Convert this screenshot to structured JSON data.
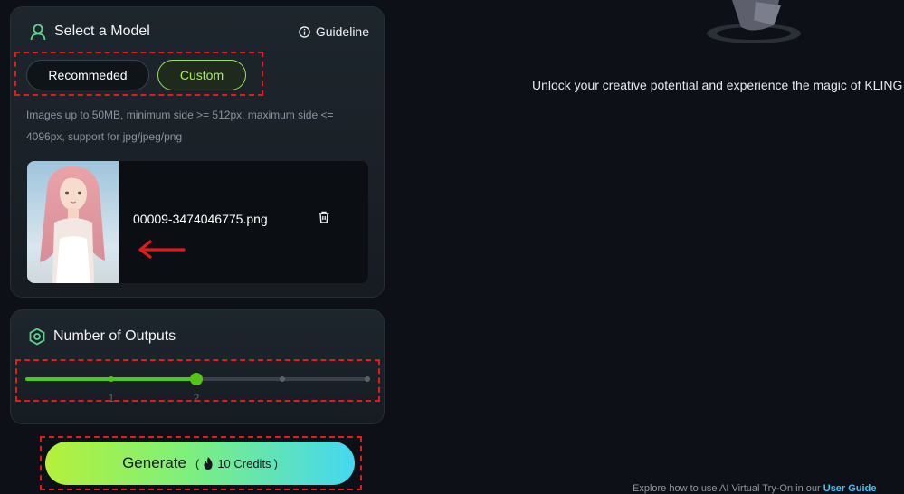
{
  "model_card": {
    "title": "Select a Model",
    "guideline": "Guideline",
    "buttons": {
      "recommended": "Recommeded",
      "custom": "Custom"
    },
    "hint": "Images up to 50MB, minimum side >= 512px, maximum side <= 4096px, support for jpg/jpeg/png",
    "file": {
      "name": "00009-3474046775.png"
    }
  },
  "outputs_card": {
    "title": "Number of Outputs",
    "slider": {
      "ticks": [
        "1",
        "2"
      ],
      "value": 2,
      "max": 4
    }
  },
  "generate": {
    "label": "Generate",
    "credits": "10 Credits"
  },
  "right_panel": {
    "message": "Unlock your creative potential and experience the magic of KLING",
    "footer_text": "Explore how to use AI Virtual Try-On in our",
    "footer_link": "User Guide"
  },
  "colors": {
    "accent_green": "#52c41a",
    "custom_green": "#a6f14e",
    "annotation_red": "#e01b1b",
    "link_blue": "#3ec4ff"
  }
}
